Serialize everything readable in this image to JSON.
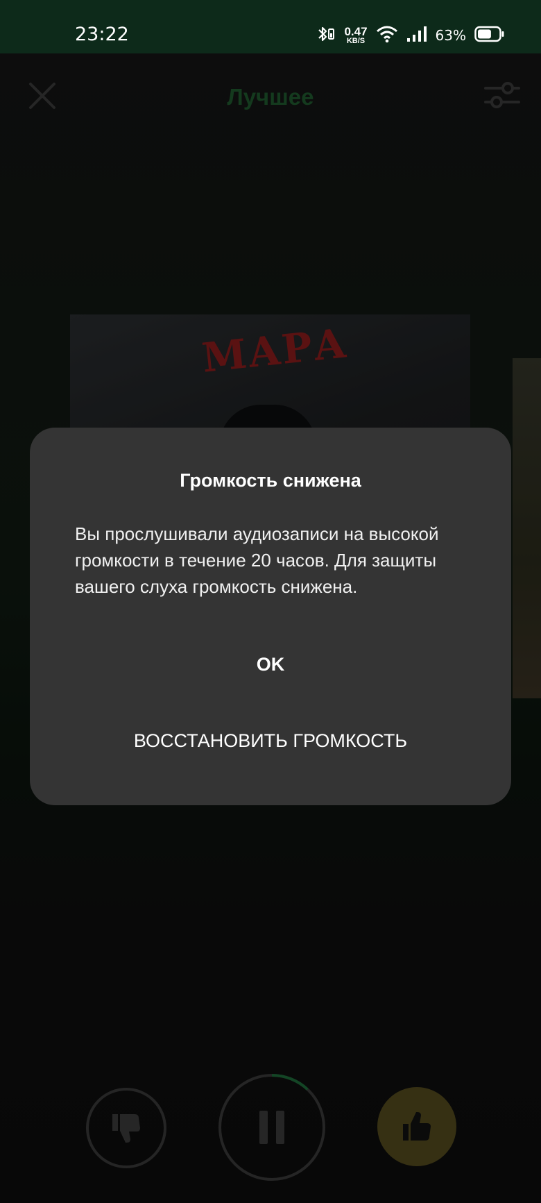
{
  "status_bar": {
    "time": "23:22",
    "net_speed_value": "0.47",
    "net_speed_unit": "KB/S",
    "battery_percent": "63%",
    "battery_level": 0.63
  },
  "header": {
    "title": "Лучшее"
  },
  "cover": {
    "art_text": "МАРА"
  },
  "dialog": {
    "title": "Громкость снижена",
    "message": "Вы прослушивали аудиозаписи на высокой громкости в течение 20 часов. Для защиты вашего слуха громкость снижена.",
    "ok_label": "OK",
    "restore_label": "ВОССТАНОВИТЬ ГРОМКОСТЬ"
  },
  "player": {
    "progress": 0.12
  },
  "colors": {
    "status_bar_bg": "#0d2a1a",
    "title_green": "#1f5a2f",
    "dialog_bg": "#343434",
    "like_bg": "#534a1e",
    "progress_green": "#1e6b3a"
  }
}
